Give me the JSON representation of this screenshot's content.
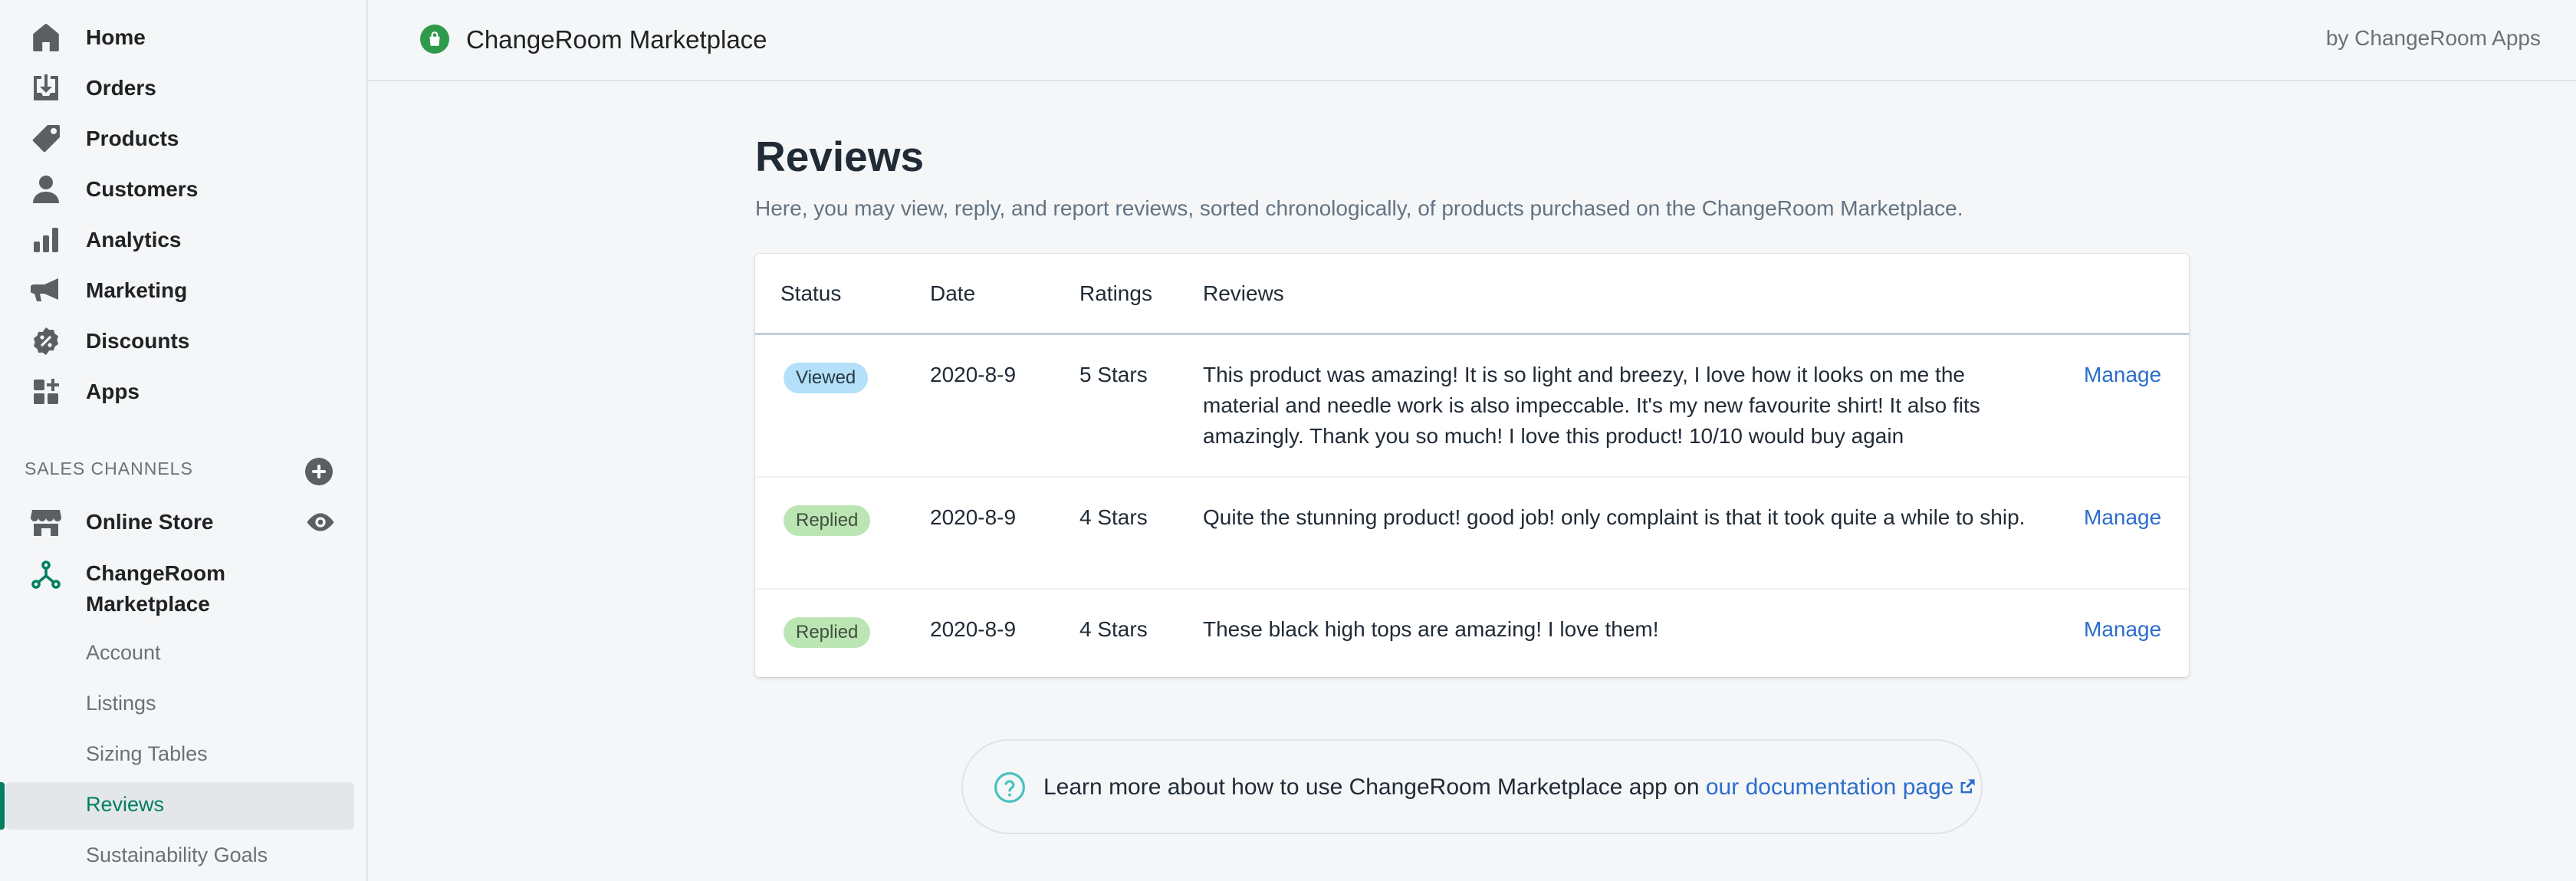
{
  "sidebar": {
    "nav": [
      {
        "label": "Home",
        "icon": "home-icon"
      },
      {
        "label": "Orders",
        "icon": "orders-icon"
      },
      {
        "label": "Products",
        "icon": "tag-icon"
      },
      {
        "label": "Customers",
        "icon": "person-icon"
      },
      {
        "label": "Analytics",
        "icon": "bar-chart-icon"
      },
      {
        "label": "Marketing",
        "icon": "megaphone-icon"
      },
      {
        "label": "Discounts",
        "icon": "discount-icon"
      },
      {
        "label": "Apps",
        "icon": "apps-icon"
      }
    ],
    "sales_channels_title": "SALES CHANNELS",
    "channels": [
      {
        "label": "Online Store",
        "icon": "store-icon"
      },
      {
        "label": "ChangeRoom Marketplace",
        "label_line1": "ChangeRoom",
        "label_line2": "Marketplace",
        "icon": "changeroom-icon"
      }
    ],
    "subnav": [
      "Account",
      "Listings",
      "Sizing Tables",
      "Reviews",
      "Sustainability Goals"
    ],
    "active_subnav": "Reviews"
  },
  "topbar": {
    "app_title": "ChangeRoom Marketplace",
    "by_line": "by ChangeRoom Apps"
  },
  "main": {
    "title": "Reviews",
    "subtitle": "Here, you may view, reply, and report reviews, sorted chronologically, of products purchased on the ChangeRoom Marketplace.",
    "table": {
      "headers": [
        "Status",
        "Date",
        "Ratings",
        "Reviews"
      ],
      "rows": [
        {
          "status": "Viewed",
          "date": "2020-8-9",
          "rating": "5 Stars",
          "review": "This product was amazing! It is so light and breezy, I love how it looks on me the material and needle work is also impeccable. It's my new favourite shirt! It also fits amazingly. Thank you so much! I love this product! 10/10 would buy again",
          "action": "Manage"
        },
        {
          "status": "Replied",
          "date": "2020-8-9",
          "rating": "4 Stars",
          "review": "Quite the stunning product! good job! only complaint is that it took quite a while to ship.",
          "action": "Manage"
        },
        {
          "status": "Replied",
          "date": "2020-8-9",
          "rating": "4 Stars",
          "review": "These black high tops are amazing! I love them!",
          "action": "Manage"
        }
      ]
    },
    "help": {
      "text": "Learn more about how to use ChangeRoom Marketplace app on ",
      "link": "our documentation page"
    }
  },
  "colors": {
    "accent_green": "#008060",
    "link_blue": "#2c6ecb",
    "badge_viewed": "#b4e0fa",
    "badge_replied": "#bbe5b3"
  }
}
